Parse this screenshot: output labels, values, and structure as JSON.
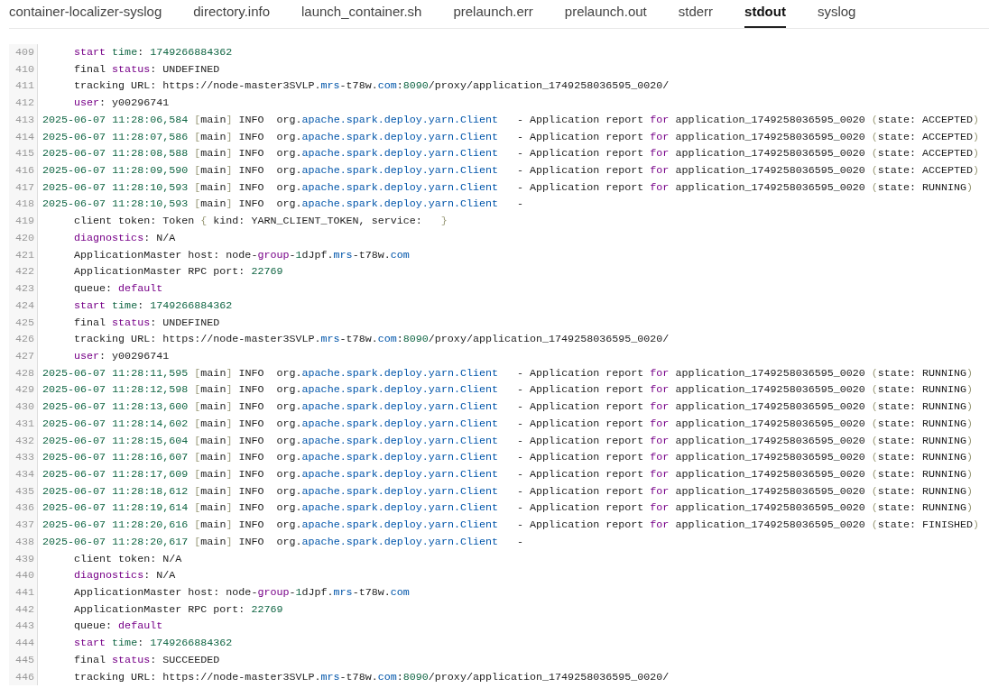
{
  "tabs": [
    {
      "label": "container-localizer-syslog",
      "selected": false
    },
    {
      "label": "directory.info",
      "selected": false
    },
    {
      "label": "launch_container.sh",
      "selected": false
    },
    {
      "label": "prelaunch.err",
      "selected": false
    },
    {
      "label": "prelaunch.out",
      "selected": false
    },
    {
      "label": "stderr",
      "selected": false
    },
    {
      "label": "stdout",
      "selected": true
    },
    {
      "label": "syslog",
      "selected": false
    }
  ],
  "log_lines": [
    {
      "number": "409",
      "indented": true,
      "segments": [
        {
          "kind": "keyword",
          "text": "start "
        },
        {
          "kind": "number",
          "text": "time"
        },
        {
          "kind": "plain",
          "text": ": "
        },
        {
          "kind": "number",
          "text": "1749266884362"
        }
      ]
    },
    {
      "number": "410",
      "indented": true,
      "segments": [
        {
          "kind": "plain",
          "text": "final "
        },
        {
          "kind": "keyword",
          "text": "status"
        },
        {
          "kind": "plain",
          "text": ": UNDEFINED"
        }
      ]
    },
    {
      "number": "411",
      "indented": true,
      "segments": [
        {
          "kind": "plain",
          "text": "tracking URL: https://node-master3SVLP."
        },
        {
          "kind": "name",
          "text": "mrs"
        },
        {
          "kind": "plain",
          "text": "-t78w."
        },
        {
          "kind": "name",
          "text": "com"
        },
        {
          "kind": "plain",
          "text": ":"
        },
        {
          "kind": "number",
          "text": "8090"
        },
        {
          "kind": "plain",
          "text": "/proxy/application_1749258036595_0020/"
        }
      ]
    },
    {
      "number": "412",
      "indented": true,
      "segments": [
        {
          "kind": "keyword",
          "text": "user"
        },
        {
          "kind": "plain",
          "text": ": y00296741"
        }
      ]
    },
    {
      "number": "413",
      "indented": false,
      "segments": [
        {
          "kind": "number",
          "text": "2025-06-07 11:28:06,584 "
        },
        {
          "kind": "bracket",
          "text": "["
        },
        {
          "kind": "plain",
          "text": "main"
        },
        {
          "kind": "bracket",
          "text": "]"
        },
        {
          "kind": "plain",
          "text": " INFO  org."
        },
        {
          "kind": "name",
          "text": "apache.spark.deploy.yarn.Client"
        },
        {
          "kind": "plain",
          "text": "   - Application report "
        },
        {
          "kind": "keyword",
          "text": "for"
        },
        {
          "kind": "plain",
          "text": " application_1749258036595_0020 "
        },
        {
          "kind": "bracket",
          "text": "("
        },
        {
          "kind": "plain",
          "text": "state: ACCEPTED"
        },
        {
          "kind": "bracket",
          "text": ")"
        }
      ]
    },
    {
      "number": "414",
      "indented": false,
      "segments": [
        {
          "kind": "number",
          "text": "2025-06-07 11:28:07,586 "
        },
        {
          "kind": "bracket",
          "text": "["
        },
        {
          "kind": "plain",
          "text": "main"
        },
        {
          "kind": "bracket",
          "text": "]"
        },
        {
          "kind": "plain",
          "text": " INFO  org."
        },
        {
          "kind": "name",
          "text": "apache.spark.deploy.yarn.Client"
        },
        {
          "kind": "plain",
          "text": "   - Application report "
        },
        {
          "kind": "keyword",
          "text": "for"
        },
        {
          "kind": "plain",
          "text": " application_1749258036595_0020 "
        },
        {
          "kind": "bracket",
          "text": "("
        },
        {
          "kind": "plain",
          "text": "state: ACCEPTED"
        },
        {
          "kind": "bracket",
          "text": ")"
        }
      ]
    },
    {
      "number": "415",
      "indented": false,
      "segments": [
        {
          "kind": "number",
          "text": "2025-06-07 11:28:08,588 "
        },
        {
          "kind": "bracket",
          "text": "["
        },
        {
          "kind": "plain",
          "text": "main"
        },
        {
          "kind": "bracket",
          "text": "]"
        },
        {
          "kind": "plain",
          "text": " INFO  org."
        },
        {
          "kind": "name",
          "text": "apache.spark.deploy.yarn.Client"
        },
        {
          "kind": "plain",
          "text": "   - Application report "
        },
        {
          "kind": "keyword",
          "text": "for"
        },
        {
          "kind": "plain",
          "text": " application_1749258036595_0020 "
        },
        {
          "kind": "bracket",
          "text": "("
        },
        {
          "kind": "plain",
          "text": "state: ACCEPTED"
        },
        {
          "kind": "bracket",
          "text": ")"
        }
      ]
    },
    {
      "number": "416",
      "indented": false,
      "segments": [
        {
          "kind": "number",
          "text": "2025-06-07 11:28:09,590 "
        },
        {
          "kind": "bracket",
          "text": "["
        },
        {
          "kind": "plain",
          "text": "main"
        },
        {
          "kind": "bracket",
          "text": "]"
        },
        {
          "kind": "plain",
          "text": " INFO  org."
        },
        {
          "kind": "name",
          "text": "apache.spark.deploy.yarn.Client"
        },
        {
          "kind": "plain",
          "text": "   - Application report "
        },
        {
          "kind": "keyword",
          "text": "for"
        },
        {
          "kind": "plain",
          "text": " application_1749258036595_0020 "
        },
        {
          "kind": "bracket",
          "text": "("
        },
        {
          "kind": "plain",
          "text": "state: ACCEPTED"
        },
        {
          "kind": "bracket",
          "text": ")"
        }
      ]
    },
    {
      "number": "417",
      "indented": false,
      "segments": [
        {
          "kind": "number",
          "text": "2025-06-07 11:28:10,593 "
        },
        {
          "kind": "bracket",
          "text": "["
        },
        {
          "kind": "plain",
          "text": "main"
        },
        {
          "kind": "bracket",
          "text": "]"
        },
        {
          "kind": "plain",
          "text": " INFO  org."
        },
        {
          "kind": "name",
          "text": "apache.spark.deploy.yarn.Client"
        },
        {
          "kind": "plain",
          "text": "   - Application report "
        },
        {
          "kind": "keyword",
          "text": "for"
        },
        {
          "kind": "plain",
          "text": " application_1749258036595_0020 "
        },
        {
          "kind": "bracket",
          "text": "("
        },
        {
          "kind": "plain",
          "text": "state: RUNNING"
        },
        {
          "kind": "bracket",
          "text": ")"
        }
      ]
    },
    {
      "number": "418",
      "indented": false,
      "segments": [
        {
          "kind": "number",
          "text": "2025-06-07 11:28:10,593 "
        },
        {
          "kind": "bracket",
          "text": "["
        },
        {
          "kind": "plain",
          "text": "main"
        },
        {
          "kind": "bracket",
          "text": "]"
        },
        {
          "kind": "plain",
          "text": " INFO  org."
        },
        {
          "kind": "name",
          "text": "apache.spark.deploy.yarn.Client"
        },
        {
          "kind": "plain",
          "text": "   -"
        }
      ]
    },
    {
      "number": "419",
      "indented": true,
      "segments": [
        {
          "kind": "plain",
          "text": "client token: Token "
        },
        {
          "kind": "bracket",
          "text": "{"
        },
        {
          "kind": "plain",
          "text": " kind: YARN_CLIENT_TOKEN, service:   "
        },
        {
          "kind": "bracket",
          "text": "}"
        }
      ]
    },
    {
      "number": "420",
      "indented": true,
      "segments": [
        {
          "kind": "keyword",
          "text": "diagnostics"
        },
        {
          "kind": "plain",
          "text": ": N/A"
        }
      ]
    },
    {
      "number": "421",
      "indented": true,
      "segments": [
        {
          "kind": "plain",
          "text": "ApplicationMaster host: node-"
        },
        {
          "kind": "keyword",
          "text": "group"
        },
        {
          "kind": "plain",
          "text": "-"
        },
        {
          "kind": "number",
          "text": "1"
        },
        {
          "kind": "plain",
          "text": "dJpf."
        },
        {
          "kind": "name",
          "text": "mrs"
        },
        {
          "kind": "plain",
          "text": "-t78w."
        },
        {
          "kind": "name",
          "text": "com"
        }
      ]
    },
    {
      "number": "422",
      "indented": true,
      "segments": [
        {
          "kind": "plain",
          "text": "ApplicationMaster RPC port: "
        },
        {
          "kind": "number",
          "text": "22769"
        }
      ]
    },
    {
      "number": "423",
      "indented": true,
      "segments": [
        {
          "kind": "plain",
          "text": "queue: "
        },
        {
          "kind": "keyword",
          "text": "default"
        }
      ]
    },
    {
      "number": "424",
      "indented": true,
      "segments": [
        {
          "kind": "keyword",
          "text": "start "
        },
        {
          "kind": "number",
          "text": "time"
        },
        {
          "kind": "plain",
          "text": ": "
        },
        {
          "kind": "number",
          "text": "1749266884362"
        }
      ]
    },
    {
      "number": "425",
      "indented": true,
      "segments": [
        {
          "kind": "plain",
          "text": "final "
        },
        {
          "kind": "keyword",
          "text": "status"
        },
        {
          "kind": "plain",
          "text": ": UNDEFINED"
        }
      ]
    },
    {
      "number": "426",
      "indented": true,
      "segments": [
        {
          "kind": "plain",
          "text": "tracking URL: https://node-master3SVLP."
        },
        {
          "kind": "name",
          "text": "mrs"
        },
        {
          "kind": "plain",
          "text": "-t78w."
        },
        {
          "kind": "name",
          "text": "com"
        },
        {
          "kind": "plain",
          "text": ":"
        },
        {
          "kind": "number",
          "text": "8090"
        },
        {
          "kind": "plain",
          "text": "/proxy/application_1749258036595_0020/"
        }
      ]
    },
    {
      "number": "427",
      "indented": true,
      "segments": [
        {
          "kind": "keyword",
          "text": "user"
        },
        {
          "kind": "plain",
          "text": ": y00296741"
        }
      ]
    },
    {
      "number": "428",
      "indented": false,
      "segments": [
        {
          "kind": "number",
          "text": "2025-06-07 11:28:11,595 "
        },
        {
          "kind": "bracket",
          "text": "["
        },
        {
          "kind": "plain",
          "text": "main"
        },
        {
          "kind": "bracket",
          "text": "]"
        },
        {
          "kind": "plain",
          "text": " INFO  org."
        },
        {
          "kind": "name",
          "text": "apache.spark.deploy.yarn.Client"
        },
        {
          "kind": "plain",
          "text": "   - Application report "
        },
        {
          "kind": "keyword",
          "text": "for"
        },
        {
          "kind": "plain",
          "text": " application_1749258036595_0020 "
        },
        {
          "kind": "bracket",
          "text": "("
        },
        {
          "kind": "plain",
          "text": "state: RUNNING"
        },
        {
          "kind": "bracket",
          "text": ")"
        }
      ]
    },
    {
      "number": "429",
      "indented": false,
      "segments": [
        {
          "kind": "number",
          "text": "2025-06-07 11:28:12,598 "
        },
        {
          "kind": "bracket",
          "text": "["
        },
        {
          "kind": "plain",
          "text": "main"
        },
        {
          "kind": "bracket",
          "text": "]"
        },
        {
          "kind": "plain",
          "text": " INFO  org."
        },
        {
          "kind": "name",
          "text": "apache.spark.deploy.yarn.Client"
        },
        {
          "kind": "plain",
          "text": "   - Application report "
        },
        {
          "kind": "keyword",
          "text": "for"
        },
        {
          "kind": "plain",
          "text": " application_1749258036595_0020 "
        },
        {
          "kind": "bracket",
          "text": "("
        },
        {
          "kind": "plain",
          "text": "state: RUNNING"
        },
        {
          "kind": "bracket",
          "text": ")"
        }
      ]
    },
    {
      "number": "430",
      "indented": false,
      "segments": [
        {
          "kind": "number",
          "text": "2025-06-07 11:28:13,600 "
        },
        {
          "kind": "bracket",
          "text": "["
        },
        {
          "kind": "plain",
          "text": "main"
        },
        {
          "kind": "bracket",
          "text": "]"
        },
        {
          "kind": "plain",
          "text": " INFO  org."
        },
        {
          "kind": "name",
          "text": "apache.spark.deploy.yarn.Client"
        },
        {
          "kind": "plain",
          "text": "   - Application report "
        },
        {
          "kind": "keyword",
          "text": "for"
        },
        {
          "kind": "plain",
          "text": " application_1749258036595_0020 "
        },
        {
          "kind": "bracket",
          "text": "("
        },
        {
          "kind": "plain",
          "text": "state: RUNNING"
        },
        {
          "kind": "bracket",
          "text": ")"
        }
      ]
    },
    {
      "number": "431",
      "indented": false,
      "segments": [
        {
          "kind": "number",
          "text": "2025-06-07 11:28:14,602 "
        },
        {
          "kind": "bracket",
          "text": "["
        },
        {
          "kind": "plain",
          "text": "main"
        },
        {
          "kind": "bracket",
          "text": "]"
        },
        {
          "kind": "plain",
          "text": " INFO  org."
        },
        {
          "kind": "name",
          "text": "apache.spark.deploy.yarn.Client"
        },
        {
          "kind": "plain",
          "text": "   - Application report "
        },
        {
          "kind": "keyword",
          "text": "for"
        },
        {
          "kind": "plain",
          "text": " application_1749258036595_0020 "
        },
        {
          "kind": "bracket",
          "text": "("
        },
        {
          "kind": "plain",
          "text": "state: RUNNING"
        },
        {
          "kind": "bracket",
          "text": ")"
        }
      ]
    },
    {
      "number": "432",
      "indented": false,
      "segments": [
        {
          "kind": "number",
          "text": "2025-06-07 11:28:15,604 "
        },
        {
          "kind": "bracket",
          "text": "["
        },
        {
          "kind": "plain",
          "text": "main"
        },
        {
          "kind": "bracket",
          "text": "]"
        },
        {
          "kind": "plain",
          "text": " INFO  org."
        },
        {
          "kind": "name",
          "text": "apache.spark.deploy.yarn.Client"
        },
        {
          "kind": "plain",
          "text": "   - Application report "
        },
        {
          "kind": "keyword",
          "text": "for"
        },
        {
          "kind": "plain",
          "text": " application_1749258036595_0020 "
        },
        {
          "kind": "bracket",
          "text": "("
        },
        {
          "kind": "plain",
          "text": "state: RUNNING"
        },
        {
          "kind": "bracket",
          "text": ")"
        }
      ]
    },
    {
      "number": "433",
      "indented": false,
      "segments": [
        {
          "kind": "number",
          "text": "2025-06-07 11:28:16,607 "
        },
        {
          "kind": "bracket",
          "text": "["
        },
        {
          "kind": "plain",
          "text": "main"
        },
        {
          "kind": "bracket",
          "text": "]"
        },
        {
          "kind": "plain",
          "text": " INFO  org."
        },
        {
          "kind": "name",
          "text": "apache.spark.deploy.yarn.Client"
        },
        {
          "kind": "plain",
          "text": "   - Application report "
        },
        {
          "kind": "keyword",
          "text": "for"
        },
        {
          "kind": "plain",
          "text": " application_1749258036595_0020 "
        },
        {
          "kind": "bracket",
          "text": "("
        },
        {
          "kind": "plain",
          "text": "state: RUNNING"
        },
        {
          "kind": "bracket",
          "text": ")"
        }
      ]
    },
    {
      "number": "434",
      "indented": false,
      "segments": [
        {
          "kind": "number",
          "text": "2025-06-07 11:28:17,609 "
        },
        {
          "kind": "bracket",
          "text": "["
        },
        {
          "kind": "plain",
          "text": "main"
        },
        {
          "kind": "bracket",
          "text": "]"
        },
        {
          "kind": "plain",
          "text": " INFO  org."
        },
        {
          "kind": "name",
          "text": "apache.spark.deploy.yarn.Client"
        },
        {
          "kind": "plain",
          "text": "   - Application report "
        },
        {
          "kind": "keyword",
          "text": "for"
        },
        {
          "kind": "plain",
          "text": " application_1749258036595_0020 "
        },
        {
          "kind": "bracket",
          "text": "("
        },
        {
          "kind": "plain",
          "text": "state: RUNNING"
        },
        {
          "kind": "bracket",
          "text": ")"
        }
      ]
    },
    {
      "number": "435",
      "indented": false,
      "segments": [
        {
          "kind": "number",
          "text": "2025-06-07 11:28:18,612 "
        },
        {
          "kind": "bracket",
          "text": "["
        },
        {
          "kind": "plain",
          "text": "main"
        },
        {
          "kind": "bracket",
          "text": "]"
        },
        {
          "kind": "plain",
          "text": " INFO  org."
        },
        {
          "kind": "name",
          "text": "apache.spark.deploy.yarn.Client"
        },
        {
          "kind": "plain",
          "text": "   - Application report "
        },
        {
          "kind": "keyword",
          "text": "for"
        },
        {
          "kind": "plain",
          "text": " application_1749258036595_0020 "
        },
        {
          "kind": "bracket",
          "text": "("
        },
        {
          "kind": "plain",
          "text": "state: RUNNING"
        },
        {
          "kind": "bracket",
          "text": ")"
        }
      ]
    },
    {
      "number": "436",
      "indented": false,
      "segments": [
        {
          "kind": "number",
          "text": "2025-06-07 11:28:19,614 "
        },
        {
          "kind": "bracket",
          "text": "["
        },
        {
          "kind": "plain",
          "text": "main"
        },
        {
          "kind": "bracket",
          "text": "]"
        },
        {
          "kind": "plain",
          "text": " INFO  org."
        },
        {
          "kind": "name",
          "text": "apache.spark.deploy.yarn.Client"
        },
        {
          "kind": "plain",
          "text": "   - Application report "
        },
        {
          "kind": "keyword",
          "text": "for"
        },
        {
          "kind": "plain",
          "text": " application_1749258036595_0020 "
        },
        {
          "kind": "bracket",
          "text": "("
        },
        {
          "kind": "plain",
          "text": "state: RUNNING"
        },
        {
          "kind": "bracket",
          "text": ")"
        }
      ]
    },
    {
      "number": "437",
      "indented": false,
      "segments": [
        {
          "kind": "number",
          "text": "2025-06-07 11:28:20,616 "
        },
        {
          "kind": "bracket",
          "text": "["
        },
        {
          "kind": "plain",
          "text": "main"
        },
        {
          "kind": "bracket",
          "text": "]"
        },
        {
          "kind": "plain",
          "text": " INFO  org."
        },
        {
          "kind": "name",
          "text": "apache.spark.deploy.yarn.Client"
        },
        {
          "kind": "plain",
          "text": "   - Application report "
        },
        {
          "kind": "keyword",
          "text": "for"
        },
        {
          "kind": "plain",
          "text": " application_1749258036595_0020 "
        },
        {
          "kind": "bracket",
          "text": "("
        },
        {
          "kind": "plain",
          "text": "state: FINISHED"
        },
        {
          "kind": "bracket",
          "text": ")"
        }
      ]
    },
    {
      "number": "438",
      "indented": false,
      "segments": [
        {
          "kind": "number",
          "text": "2025-06-07 11:28:20,617 "
        },
        {
          "kind": "bracket",
          "text": "["
        },
        {
          "kind": "plain",
          "text": "main"
        },
        {
          "kind": "bracket",
          "text": "]"
        },
        {
          "kind": "plain",
          "text": " INFO  org."
        },
        {
          "kind": "name",
          "text": "apache.spark.deploy.yarn.Client"
        },
        {
          "kind": "plain",
          "text": "   -"
        }
      ]
    },
    {
      "number": "439",
      "indented": true,
      "segments": [
        {
          "kind": "plain",
          "text": "client token: N/A"
        }
      ]
    },
    {
      "number": "440",
      "indented": true,
      "segments": [
        {
          "kind": "keyword",
          "text": "diagnostics"
        },
        {
          "kind": "plain",
          "text": ": N/A"
        }
      ]
    },
    {
      "number": "441",
      "indented": true,
      "segments": [
        {
          "kind": "plain",
          "text": "ApplicationMaster host: node-"
        },
        {
          "kind": "keyword",
          "text": "group"
        },
        {
          "kind": "plain",
          "text": "-"
        },
        {
          "kind": "number",
          "text": "1"
        },
        {
          "kind": "plain",
          "text": "dJpf."
        },
        {
          "kind": "name",
          "text": "mrs"
        },
        {
          "kind": "plain",
          "text": "-t78w."
        },
        {
          "kind": "name",
          "text": "com"
        }
      ]
    },
    {
      "number": "442",
      "indented": true,
      "segments": [
        {
          "kind": "plain",
          "text": "ApplicationMaster RPC port: "
        },
        {
          "kind": "number",
          "text": "22769"
        }
      ]
    },
    {
      "number": "443",
      "indented": true,
      "segments": [
        {
          "kind": "plain",
          "text": "queue: "
        },
        {
          "kind": "keyword",
          "text": "default"
        }
      ]
    },
    {
      "number": "444",
      "indented": true,
      "segments": [
        {
          "kind": "keyword",
          "text": "start "
        },
        {
          "kind": "number",
          "text": "time"
        },
        {
          "kind": "plain",
          "text": ": "
        },
        {
          "kind": "number",
          "text": "1749266884362"
        }
      ]
    },
    {
      "number": "445",
      "indented": true,
      "segments": [
        {
          "kind": "plain",
          "text": "final "
        },
        {
          "kind": "keyword",
          "text": "status"
        },
        {
          "kind": "plain",
          "text": ": SUCCEEDED"
        }
      ]
    },
    {
      "number": "446",
      "indented": true,
      "segments": [
        {
          "kind": "plain",
          "text": "tracking URL: https://node-master3SVLP."
        },
        {
          "kind": "name",
          "text": "mrs"
        },
        {
          "kind": "plain",
          "text": "-t78w."
        },
        {
          "kind": "name",
          "text": "com"
        },
        {
          "kind": "plain",
          "text": ":"
        },
        {
          "kind": "number",
          "text": "8090"
        },
        {
          "kind": "plain",
          "text": "/proxy/application_1749258036595_0020/"
        }
      ]
    }
  ]
}
